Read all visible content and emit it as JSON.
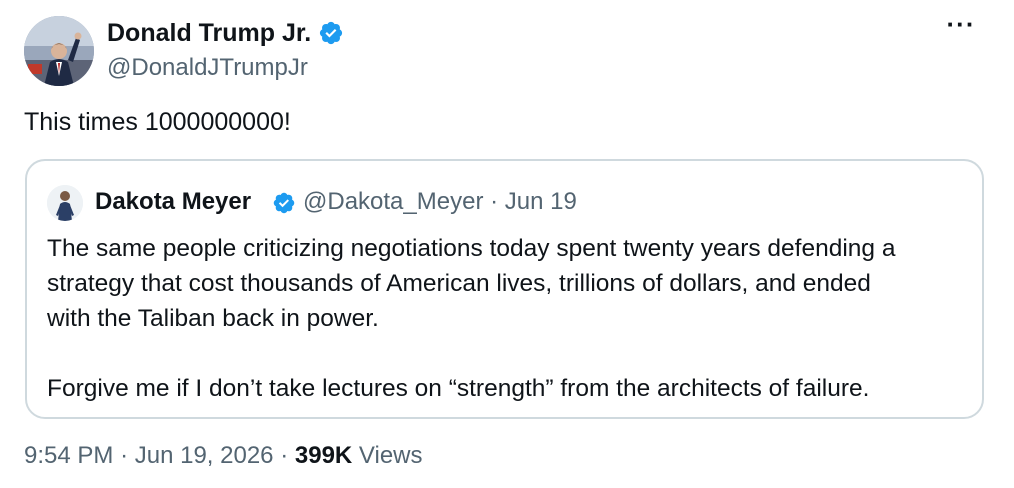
{
  "author": {
    "display_name": "Donald Trump Jr.",
    "handle": "@DonaldJTrumpJr",
    "verified_icon": "verified-badge-icon"
  },
  "tweet": {
    "text": "This times 1000000000!"
  },
  "more_menu": {
    "label": "···"
  },
  "quote": {
    "display_name": "Dakota Meyer",
    "handle": "@Dakota_Meyer",
    "separator": "·",
    "date": "Jun 19",
    "paragraphs": [
      "The same people criticizing negotiations today spent twenty years defending a",
      "strategy that cost thousands of American lives, trillions of dollars, and ended",
      "with the Taliban back in power.",
      "Forgive me if I don’t take lectures on “strength” from the architects of failure."
    ]
  },
  "footer": {
    "time": "9:54 PM",
    "separator": "·",
    "date": "Jun 19, 2026",
    "views_count": "399K",
    "views_label": "Views"
  },
  "colors": {
    "verified_blue": "#1d9bf0",
    "text_primary": "#0f1419",
    "text_secondary": "#536471",
    "border": "#cfd9de"
  }
}
